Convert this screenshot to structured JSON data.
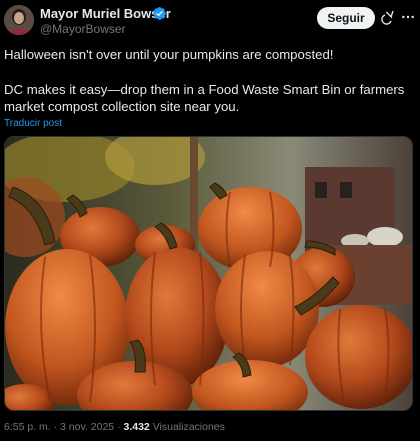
{
  "author": {
    "name": "Mayor Muriel Bowser",
    "handle": "@MayorBowser",
    "verified": true
  },
  "follow_label": "Seguir",
  "tweet": {
    "line1": "Halloween isn't over until your pumpkins are composted!",
    "line2": "DC makes it easy—drop them in a Food Waste Smart Bin or farmers market compost collection site near you.",
    "translate_label": "Traducir post"
  },
  "meta": {
    "time": "6:55 p. m.",
    "sep1": "·",
    "date": "3 nov. 2025",
    "sep2": "·",
    "views": "3.432",
    "views_label": "Visualizaciones"
  },
  "icons": {
    "verified": "verified-badge-icon",
    "grok": "grok-icon",
    "more": "more-options-icon"
  },
  "colors": {
    "background": "#000000",
    "text": "#e7e9ea",
    "muted": "#71767b",
    "link": "#1d9bf0",
    "follow_bg": "#eff3f4"
  }
}
